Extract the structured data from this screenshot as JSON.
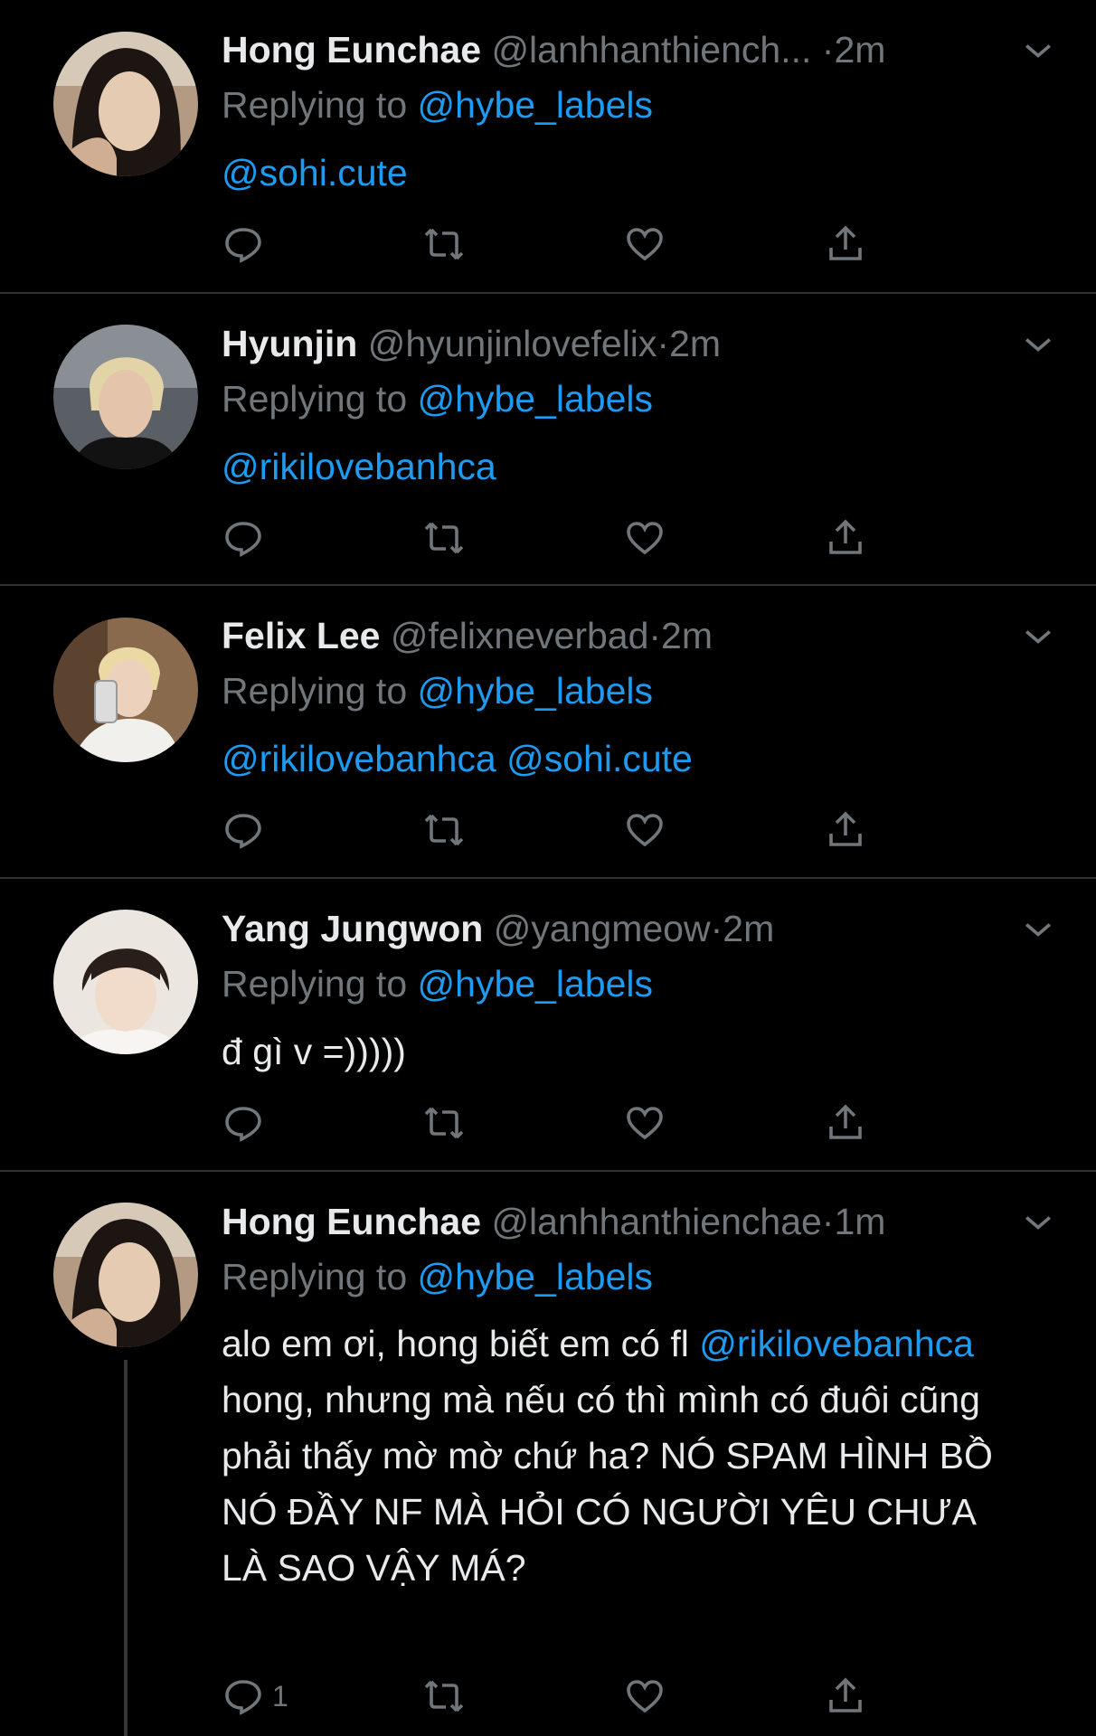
{
  "tweets": [
    {
      "name": "Hong Eunchae",
      "handle": "@lanhhanthiench...",
      "dot": "·",
      "time": "2m",
      "reply_prefix": "Replying to",
      "reply_to": "@hybe_labels",
      "body": [
        {
          "t": "@sohi.cute",
          "link": true
        }
      ],
      "reply_count": "",
      "avatar": "woman-dark-hair-avatar"
    },
    {
      "name": "Hyunjin",
      "handle": "@hyunjinlovefelix",
      "dot": "·",
      "time": "2m",
      "reply_prefix": "Replying to",
      "reply_to": "@hybe_labels",
      "body": [
        {
          "t": "@rikilovebanhca",
          "link": true
        }
      ],
      "reply_count": "",
      "avatar": "blond-man-avatar"
    },
    {
      "name": "Felix Lee",
      "handle": "@felixneverbad",
      "dot": "·",
      "time": "2m",
      "reply_prefix": "Replying to",
      "reply_to": "@hybe_labels",
      "body": [
        {
          "t": "@rikilovebanhca",
          "link": true
        },
        {
          "t": " ",
          "link": false
        },
        {
          "t": "@sohi.cute",
          "link": true
        }
      ],
      "reply_count": "",
      "avatar": "blond-mirror-selfie-avatar"
    },
    {
      "name": "Yang Jungwon",
      "handle": "@yangmeow",
      "dot": "·",
      "time": "2m",
      "reply_prefix": "Replying to",
      "reply_to": "@hybe_labels",
      "body": [
        {
          "t": "đ gì v =)))))",
          "link": false
        }
      ],
      "reply_count": "",
      "avatar": "dark-hair-boy-avatar"
    },
    {
      "name": "Hong Eunchae",
      "handle": "@lanhhanthienchae",
      "dot": "·",
      "time": "1m",
      "reply_prefix": "Replying to",
      "reply_to": "@hybe_labels",
      "body": [
        {
          "t": "alo em ơi, hong biết em có fl ",
          "link": false
        },
        {
          "t": "@rikilovebanhca",
          "link": true
        },
        {
          "t": " hong, nhưng mà nếu có thì mình có đuôi cũng phải thấy mờ mờ chứ ha? NÓ SPAM HÌNH BỒ NÓ ĐẦY NF MÀ HỎI CÓ NGƯỜI YÊU CHƯA LÀ SAO VẬY MÁ?",
          "link": false
        }
      ],
      "reply_count": "1",
      "avatar": "woman-dark-hair-avatar"
    }
  ],
  "colors": {
    "link": "#1d9bf0",
    "muted": "#71767b",
    "divider": "#2f3336"
  }
}
